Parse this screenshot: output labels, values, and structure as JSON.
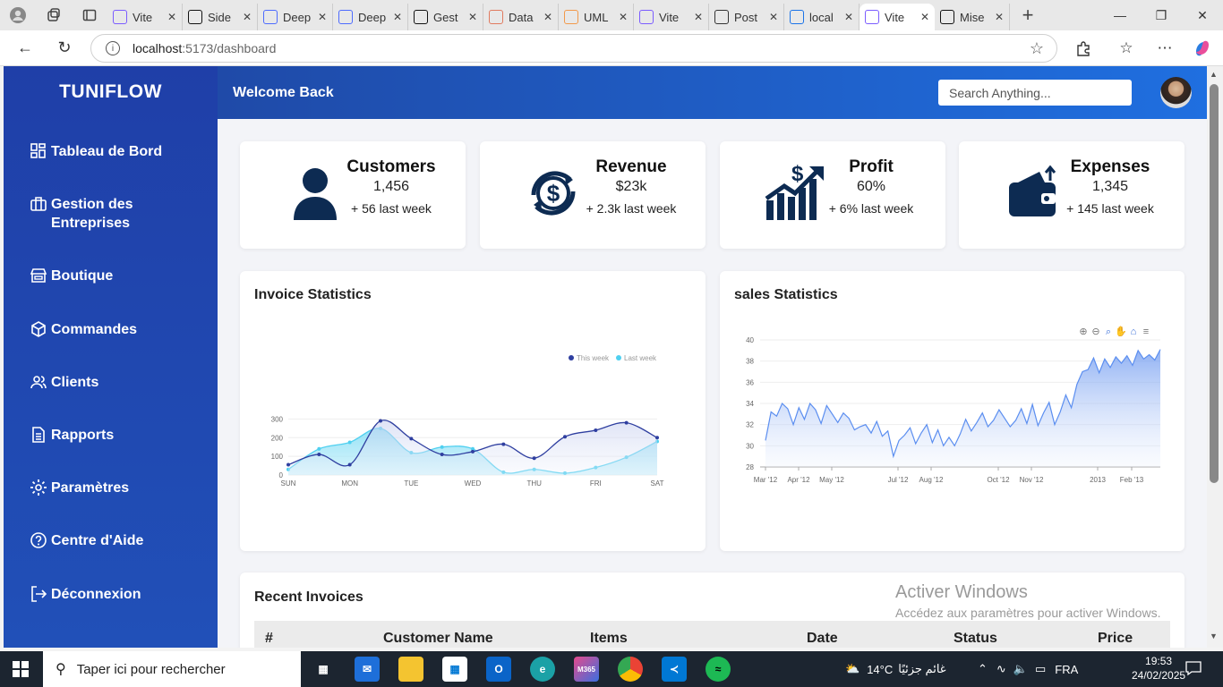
{
  "browser": {
    "tabs": [
      {
        "title": "Vite",
        "icon": "vite-icon",
        "color": "#7b5cff"
      },
      {
        "title": "Side",
        "icon": "openai-icon",
        "color": "#111111"
      },
      {
        "title": "Deep",
        "icon": "deepseek-icon",
        "color": "#4d6bfe"
      },
      {
        "title": "Deep",
        "icon": "deepseek-icon",
        "color": "#4d6bfe"
      },
      {
        "title": "Gest",
        "icon": "openai-icon",
        "color": "#111111"
      },
      {
        "title": "Data",
        "icon": "data-icon",
        "color": "#e07a5f"
      },
      {
        "title": "UML",
        "icon": "uml-icon",
        "color": "#f2994a"
      },
      {
        "title": "Vite",
        "icon": "vite-icon",
        "color": "#7b5cff"
      },
      {
        "title": "Post",
        "icon": "globe-icon",
        "color": "#333333"
      },
      {
        "title": "local",
        "icon": "search-icon",
        "color": "#1a73e8"
      },
      {
        "title": "Vite",
        "icon": "vite-icon",
        "color": "#7b5cff",
        "active": true
      },
      {
        "title": "Mise",
        "icon": "openai-icon",
        "color": "#111111"
      }
    ],
    "url_host": "localhost",
    "url_path": ":5173/dashboard"
  },
  "app": {
    "brand": "TUNIFLOW",
    "welcome": "Welcome Back",
    "search_placeholder": "Search Anything...",
    "nav": [
      {
        "label": "Tableau de Bord",
        "icon": "dashboard-grid-icon"
      },
      {
        "label": "Gestion des Entreprises",
        "icon": "briefcase-icon"
      },
      {
        "label": "Boutique",
        "icon": "store-icon"
      },
      {
        "label": "Commandes",
        "icon": "box-icon"
      },
      {
        "label": "Clients",
        "icon": "users-icon"
      },
      {
        "label": "Rapports",
        "icon": "document-icon"
      },
      {
        "label": "Paramètres",
        "icon": "gear-icon"
      },
      {
        "label": "Centre d'Aide",
        "icon": "help-icon"
      },
      {
        "label": "Déconnexion",
        "icon": "logout-icon"
      }
    ],
    "stats": [
      {
        "title": "Customers",
        "value": "1,456",
        "sub": "+ 56 last week",
        "icon": "customer-icon"
      },
      {
        "title": "Revenue",
        "value": "$23k",
        "sub": "+ 2.3k last week",
        "icon": "revenue-icon"
      },
      {
        "title": "Profit",
        "value": "60%",
        "sub": "+ 6% last week",
        "icon": "profit-chart-icon"
      },
      {
        "title": "Expenses",
        "value": "1,345",
        "sub": "+ 145 last week",
        "icon": "wallet-icon"
      }
    ],
    "invoice_title": "Invoice Statistics",
    "sales_title": "sales Statistics",
    "recent_title": "Recent Invoices",
    "table_headers": [
      "#",
      "Customer Name",
      "Items",
      "Date",
      "Status",
      "Price"
    ],
    "activate_line1": "Activer Windows",
    "activate_line2": "Accédez aux paramètres pour activer Windows."
  },
  "chart_data": [
    {
      "type": "area",
      "title": "Invoice Statistics",
      "categories": [
        "SUN",
        "MON",
        "TUE",
        "WED",
        "THU",
        "FRI",
        "SAT"
      ],
      "yticks": [
        0,
        100,
        200,
        300
      ],
      "ylim": [
        0,
        350
      ],
      "legend_position": "top-right",
      "series": [
        {
          "name": "This week",
          "color": "#2f3fa0",
          "values": [
            55,
            110,
            55,
            290,
            195,
            110,
            125,
            165,
            90,
            205,
            240,
            280,
            200
          ]
        },
        {
          "name": "Last week",
          "color": "#4fd0f0",
          "values": [
            30,
            140,
            175,
            250,
            120,
            150,
            140,
            15,
            30,
            10,
            40,
            95,
            180
          ]
        }
      ]
    },
    {
      "type": "area",
      "title": "sales Statistics",
      "yticks": [
        28,
        30,
        32,
        34,
        36,
        38,
        40
      ],
      "ylim": [
        28,
        40
      ],
      "xticks": [
        "Mar '12",
        "Apr '12",
        "May '12",
        "Jul '12",
        "Aug '12",
        "Oct '12",
        "Nov '12",
        "2013",
        "Feb '13"
      ],
      "toolbar_icons": [
        "zoom-in-icon",
        "zoom-out-icon",
        "zoom-select-icon",
        "pan-icon",
        "home-icon",
        "menu-icon"
      ],
      "color": "#5b8ef0",
      "values": [
        30.5,
        33.2,
        32.8,
        34,
        33.5,
        32,
        33.6,
        32.5,
        34,
        33.4,
        32.1,
        33.8,
        33,
        32.2,
        33.1,
        32.6,
        31.5,
        31.8,
        32,
        31.2,
        32.3,
        30.9,
        31.4,
        29,
        30.5,
        31,
        31.7,
        30.2,
        31.2,
        32,
        30.3,
        31.5,
        30,
        30.8,
        30,
        31.1,
        32.5,
        31.4,
        32.2,
        33.1,
        31.8,
        32.4,
        33.4,
        32.6,
        31.8,
        32.4,
        33.5,
        32.1,
        33.9,
        31.9,
        33.1,
        34.1,
        32,
        33.2,
        34.8,
        33.6,
        35.8,
        37,
        37.2,
        38.3,
        36.9,
        38.2,
        37.4,
        38.4,
        37.8,
        38.5,
        37.6,
        39,
        38.2,
        38.6,
        38.1,
        39.1
      ]
    }
  ],
  "taskbar": {
    "search_placeholder": "Taper ici pour rechercher",
    "weather": "14°C",
    "weather_text": "غائم جزئيًا",
    "lang": "FRA",
    "time": "19:53",
    "date": "24/02/2025"
  }
}
